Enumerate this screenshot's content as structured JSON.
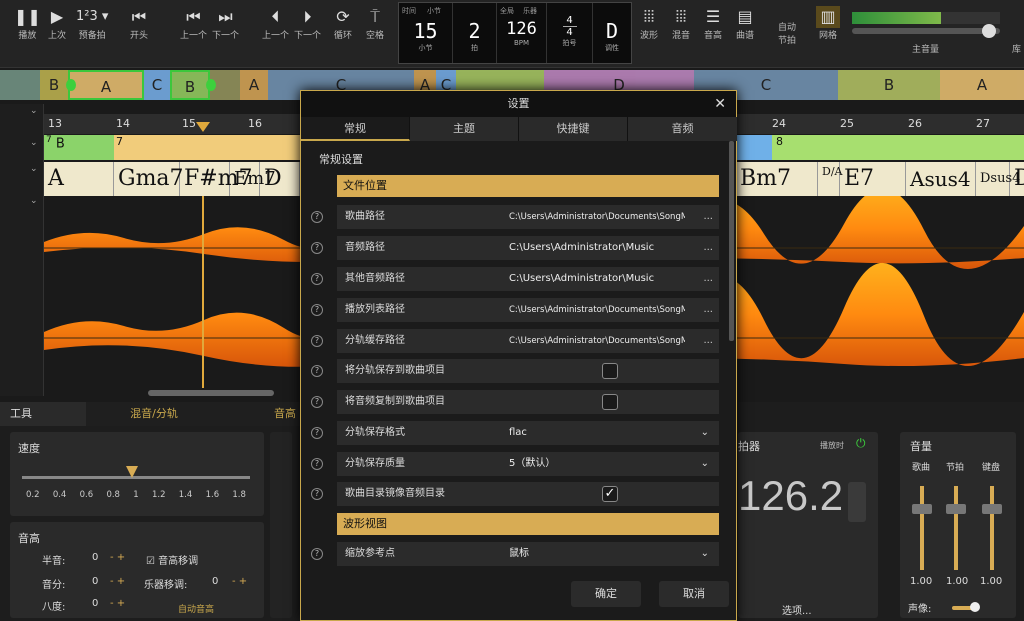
{
  "toolbar": {
    "play": "播放",
    "prev": "上次",
    "precount": "预备拍",
    "start": "开头",
    "prev_a": "上一个",
    "next_a": "下一个",
    "prev_b": "上一个",
    "next_b": "下一个",
    "loop": "循环",
    "space": "空格",
    "waveform": "波形",
    "mix": "混音",
    "pitch": "音高",
    "score": "曲谱",
    "auto": "自动",
    "tempo_link": "节拍",
    "grid": "网格",
    "master": "主音量",
    "more": "库"
  },
  "position": {
    "time_cap": "时间",
    "bar_cap": "小节",
    "beat_label": "小节",
    "bar": "15",
    "beat_cap": "",
    "beat": "2",
    "beat_label2": "拍",
    "total_cap": "全局",
    "tempo_cap": "乐器",
    "bpm": "126",
    "bpm_label": "BPM",
    "sig_top": "4",
    "sig_bot": "4",
    "sig_label": "拍号",
    "key": "D",
    "key_label": "调性"
  },
  "strip": [
    "B",
    "A",
    "C",
    "B",
    "A",
    "C",
    "A",
    "C",
    "D",
    "C",
    "B",
    "A"
  ],
  "ruler": [
    "13",
    "14",
    "15",
    "16",
    "24",
    "25",
    "26",
    "27"
  ],
  "sections": {
    "left_num": "7",
    "left": "B",
    "mid_num": "7",
    "right_num": "8"
  },
  "chords": [
    "A",
    "Gma7",
    "F#m7",
    "Em7",
    "D",
    "Bm7",
    "D/A",
    "E7",
    "Asus4",
    "Dsus4",
    "D"
  ],
  "bottom": {
    "tab_tools": "工具",
    "tab_mix": "混音/分轨",
    "tab_pitch": "音高",
    "speed": "速度",
    "speed_ticks": [
      "0.2",
      "0.4",
      "0.6",
      "0.8",
      "1",
      "1.2",
      "1.4",
      "1.6",
      "1.8"
    ],
    "pitch": "音高",
    "semitone": "半音:",
    "semitone_val": "0",
    "cents": "音分:",
    "cents_val": "0",
    "octave": "八度:",
    "octave_val": "0",
    "pitch_shift": "音高移调",
    "instr_shift": "乐器移调:",
    "instr_val": "0",
    "auto_pitch": "自动音高",
    "metro": "拍器",
    "metro_right": "播放时",
    "tempo_big": "126.2",
    "options": "选项...",
    "volume": "音量",
    "vol_song": "歌曲",
    "vol_click": "节拍",
    "vol_keys": "键盘",
    "vol_vals": [
      "1.00",
      "1.00",
      "1.00"
    ],
    "pan": "声像:"
  },
  "dialog": {
    "title": "设置",
    "tabs": [
      "常规",
      "主题",
      "快捷键",
      "音频"
    ],
    "heading": "常规设置",
    "sec_files": "文件位置",
    "song_path": "歌曲路径",
    "song_path_val": "C:\\Users\\Administrator\\Documents\\SongMaster\\...",
    "audio_path": "音频路径",
    "audio_path_val": "C:\\Users\\Administrator\\Music",
    "other_path": "其他音频路径",
    "other_path_val": "C:\\Users\\Administrator\\Music",
    "playlist_path": "播放列表路径",
    "playlist_path_val": "C:\\Users\\Administrator\\Documents\\SongMaster\\...",
    "stem_cache": "分轨缓存路径",
    "stem_cache_val": "C:\\Users\\Administrator\\Documents\\SongMaster\\...",
    "save_stems": "将分轨保存到歌曲项目",
    "copy_audio": "将音频复制到歌曲项目",
    "stem_format": "分轨保存格式",
    "stem_format_val": "flac",
    "stem_quality": "分轨保存质量",
    "stem_quality_val": "5（默认）",
    "mirror": "歌曲目录镜像音频目录",
    "sec_wave": "波形视图",
    "zoom_ref": "缩放参考点",
    "zoom_ref_val": "鼠标",
    "ok": "确定",
    "cancel": "取消",
    "dots": "...",
    "help": "?"
  }
}
